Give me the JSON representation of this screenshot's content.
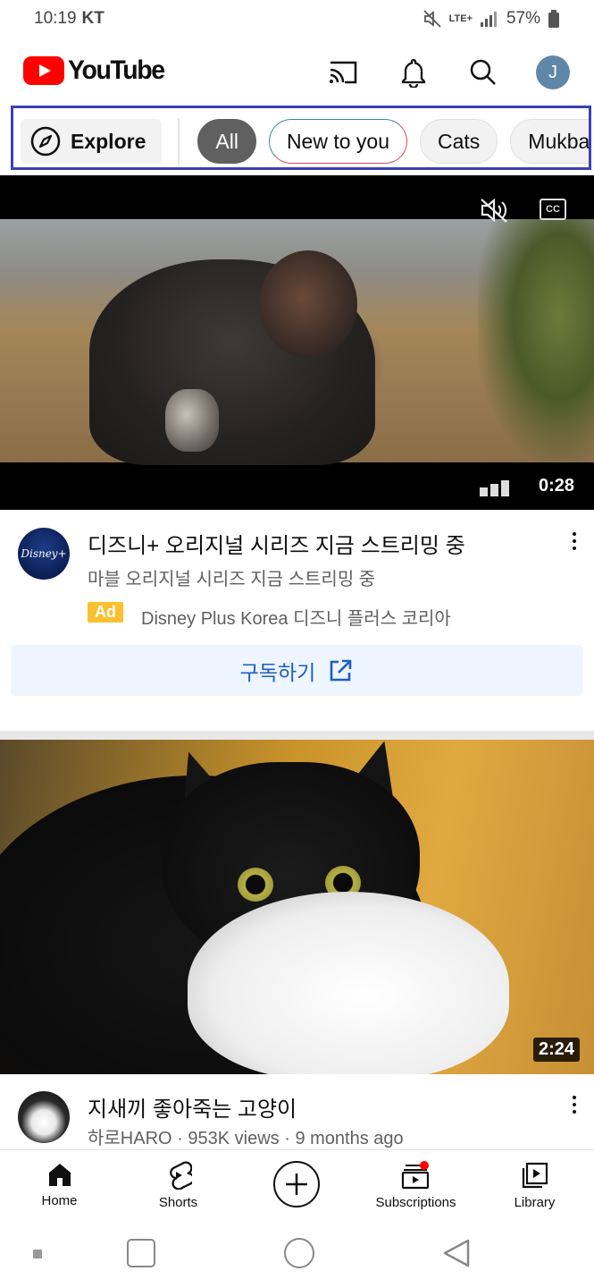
{
  "status_bar": {
    "time": "10:19",
    "carrier": "KT",
    "network": "LTE+",
    "battery": "57%"
  },
  "header": {
    "logo_text": "YouTube",
    "avatar_initial": "J"
  },
  "chips": [
    {
      "label": "Explore",
      "type": "explore"
    },
    {
      "label": "All",
      "type": "active"
    },
    {
      "label": "New to you",
      "type": "new"
    },
    {
      "label": "Cats",
      "type": "normal"
    },
    {
      "label": "Mukbang",
      "type": "normal"
    }
  ],
  "ad_video": {
    "duration": "0:28",
    "title": "디즈니+ 오리지널 시리즈 지금 스트리밍 중",
    "subtitle": "마블 오리지널 시리즈 지금 스트리밍 중",
    "ad_badge": "Ad",
    "advertiser": "Disney Plus Korea 디즈니 플러스 코리아",
    "cta_label": "구독하기",
    "channel_logo_text": "Disney+",
    "cc_label": "CC"
  },
  "video2": {
    "duration": "2:24",
    "title": "지새끼 좋아죽는 고양이",
    "channel": "하로HARO",
    "views": "953K views",
    "age": "9 months ago",
    "separator": "·"
  },
  "bottom_nav": [
    {
      "label": "Home",
      "icon": "home-icon"
    },
    {
      "label": "Shorts",
      "icon": "shorts-icon"
    },
    {
      "label": "",
      "icon": "create-icon"
    },
    {
      "label": "Subscriptions",
      "icon": "subscriptions-icon"
    },
    {
      "label": "Library",
      "icon": "library-icon"
    }
  ],
  "colors": {
    "brand_red": "#ff0000",
    "chip_highlight": "#3b3fb8",
    "link_blue": "#1a5fc1",
    "ad_yellow": "#fbc02d"
  }
}
